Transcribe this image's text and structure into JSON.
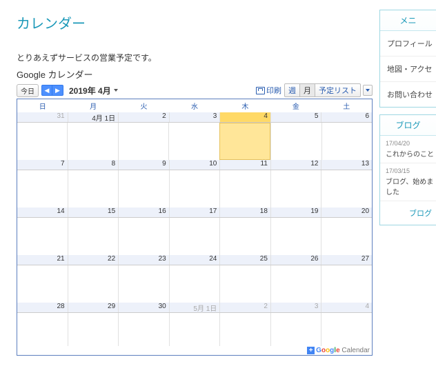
{
  "page": {
    "title": "カレンダー",
    "description": "とりあえずサービスの営業予定です。",
    "calendar_name": "Google カレンダー"
  },
  "toolbar": {
    "today": "今日",
    "month_label": "2019年 4月",
    "print": "印刷",
    "view_week": "週",
    "view_month": "月",
    "view_agenda": "予定リスト"
  },
  "dow": [
    "日",
    "月",
    "火",
    "水",
    "木",
    "金",
    "土"
  ],
  "weeks": [
    [
      {
        "n": "31",
        "other": true
      },
      {
        "n": "4月 1日"
      },
      {
        "n": "2"
      },
      {
        "n": "3"
      },
      {
        "n": "4",
        "today": true
      },
      {
        "n": "5"
      },
      {
        "n": "6"
      }
    ],
    [
      {
        "n": "7"
      },
      {
        "n": "8"
      },
      {
        "n": "9"
      },
      {
        "n": "10"
      },
      {
        "n": "11"
      },
      {
        "n": "12"
      },
      {
        "n": "13"
      }
    ],
    [
      {
        "n": "14"
      },
      {
        "n": "15"
      },
      {
        "n": "16"
      },
      {
        "n": "17"
      },
      {
        "n": "18"
      },
      {
        "n": "19"
      },
      {
        "n": "20"
      }
    ],
    [
      {
        "n": "21"
      },
      {
        "n": "22"
      },
      {
        "n": "23"
      },
      {
        "n": "24"
      },
      {
        "n": "25"
      },
      {
        "n": "26"
      },
      {
        "n": "27"
      }
    ],
    [
      {
        "n": "28"
      },
      {
        "n": "29"
      },
      {
        "n": "30"
      },
      {
        "n": "5月 1日",
        "other": true
      },
      {
        "n": "2",
        "other": true
      },
      {
        "n": "3",
        "other": true
      },
      {
        "n": "4",
        "other": true
      }
    ]
  ],
  "footer": {
    "google": "Google",
    "calendar": "Calendar"
  },
  "sidebar": {
    "menu_title": "メニ",
    "menu_items": [
      "プロフィール",
      "地図・アクセ",
      "お問い合わせ"
    ],
    "blog_title": "ブログ",
    "blog_posts": [
      {
        "date": "17/04/20",
        "title": "これからのこと"
      },
      {
        "date": "17/03/15",
        "title": "ブログ、始めました"
      }
    ],
    "blog_more": "ブログ"
  }
}
